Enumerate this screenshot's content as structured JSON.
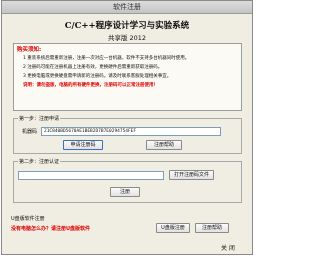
{
  "window": {
    "title": "软件注册"
  },
  "header": {
    "app_title": "C/C++程序设计学习与实验系统",
    "subtitle": "共享版 2012"
  },
  "notice": {
    "heading": "购买须知:",
    "lines": [
      "1 重装系统后需重新注册，注册一次对应一台机器，软件不支持多台机器同时使用。",
      "2 注册码可能在注册机器上注册有效，更换硬件后需重新获取注册码。",
      "3 更换电脑或更换硬盘需申请新的注册码，请及时联系客服处理相关事宜。"
    ],
    "warning": "说明：请勿盗版，电脑的所有硬件更换，注册码可以正常注册使用！"
  },
  "step1": {
    "legend": "第一步：注册申请",
    "machine_code_label": "机器码",
    "machine_code_value": "21C840BD5670AE1BEB2D7B7E0294754FEF",
    "apply_button": "申请注册码",
    "help_button": "注册帮助"
  },
  "step2": {
    "legend": "第二步：注册认证",
    "reg_code_value": "",
    "open_file_button": "打开注册码文件",
    "register_button": "注册"
  },
  "footer": {
    "upgrade_label": "U盘版软件注册",
    "promo_text": "没有电脑怎么办？请注册U盘版软件",
    "usb_register_button": "U盘版注册",
    "usb_help_button": "注册帮助",
    "close_label": "关 闭"
  }
}
